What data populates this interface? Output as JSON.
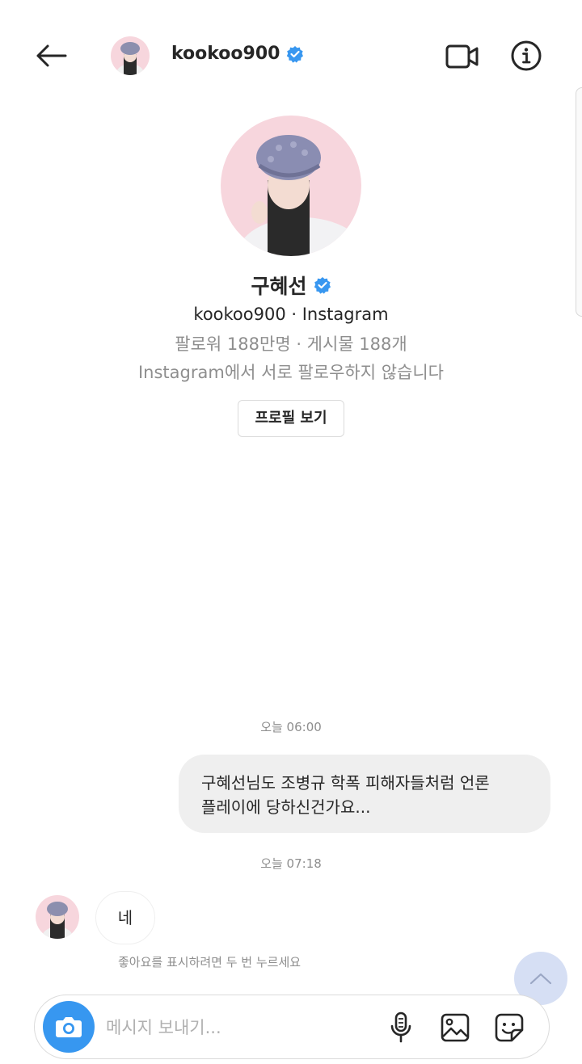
{
  "header": {
    "username": "kookoo900",
    "verified_icon": "verified-badge-icon",
    "icons": [
      "back-arrow-icon",
      "video-call-icon",
      "info-icon"
    ]
  },
  "profile": {
    "name": "구혜선",
    "handle": "kookoo900 · Instagram",
    "stats": "팔로워 188만명 · 게시물 188개",
    "follow_status": "Instagram에서 서로 팔로우하지 않습니다",
    "view_profile_label": "프로필 보기"
  },
  "messages": [
    {
      "timestamp": "오늘 06:00",
      "direction": "sent",
      "lines": [
        "구혜선님도 조병규 학폭 피해자들처럼 언론",
        "플레이에 당하신건가요..."
      ]
    },
    {
      "timestamp": "오늘 07:18",
      "direction": "received",
      "text": "네",
      "hint": "좋아요를 표시하려면 두 번 누르세요"
    }
  ],
  "composer": {
    "placeholder": "메시지 보내기...",
    "icons": [
      "camera-icon",
      "microphone-icon",
      "gallery-icon",
      "sticker-icon"
    ]
  },
  "colors": {
    "accent": "#3797f0",
    "verified": "#3897f0",
    "muted_text": "#8e8e8e",
    "bubble_bg": "#efefef",
    "avatar_bg": "#f7d6dd"
  }
}
